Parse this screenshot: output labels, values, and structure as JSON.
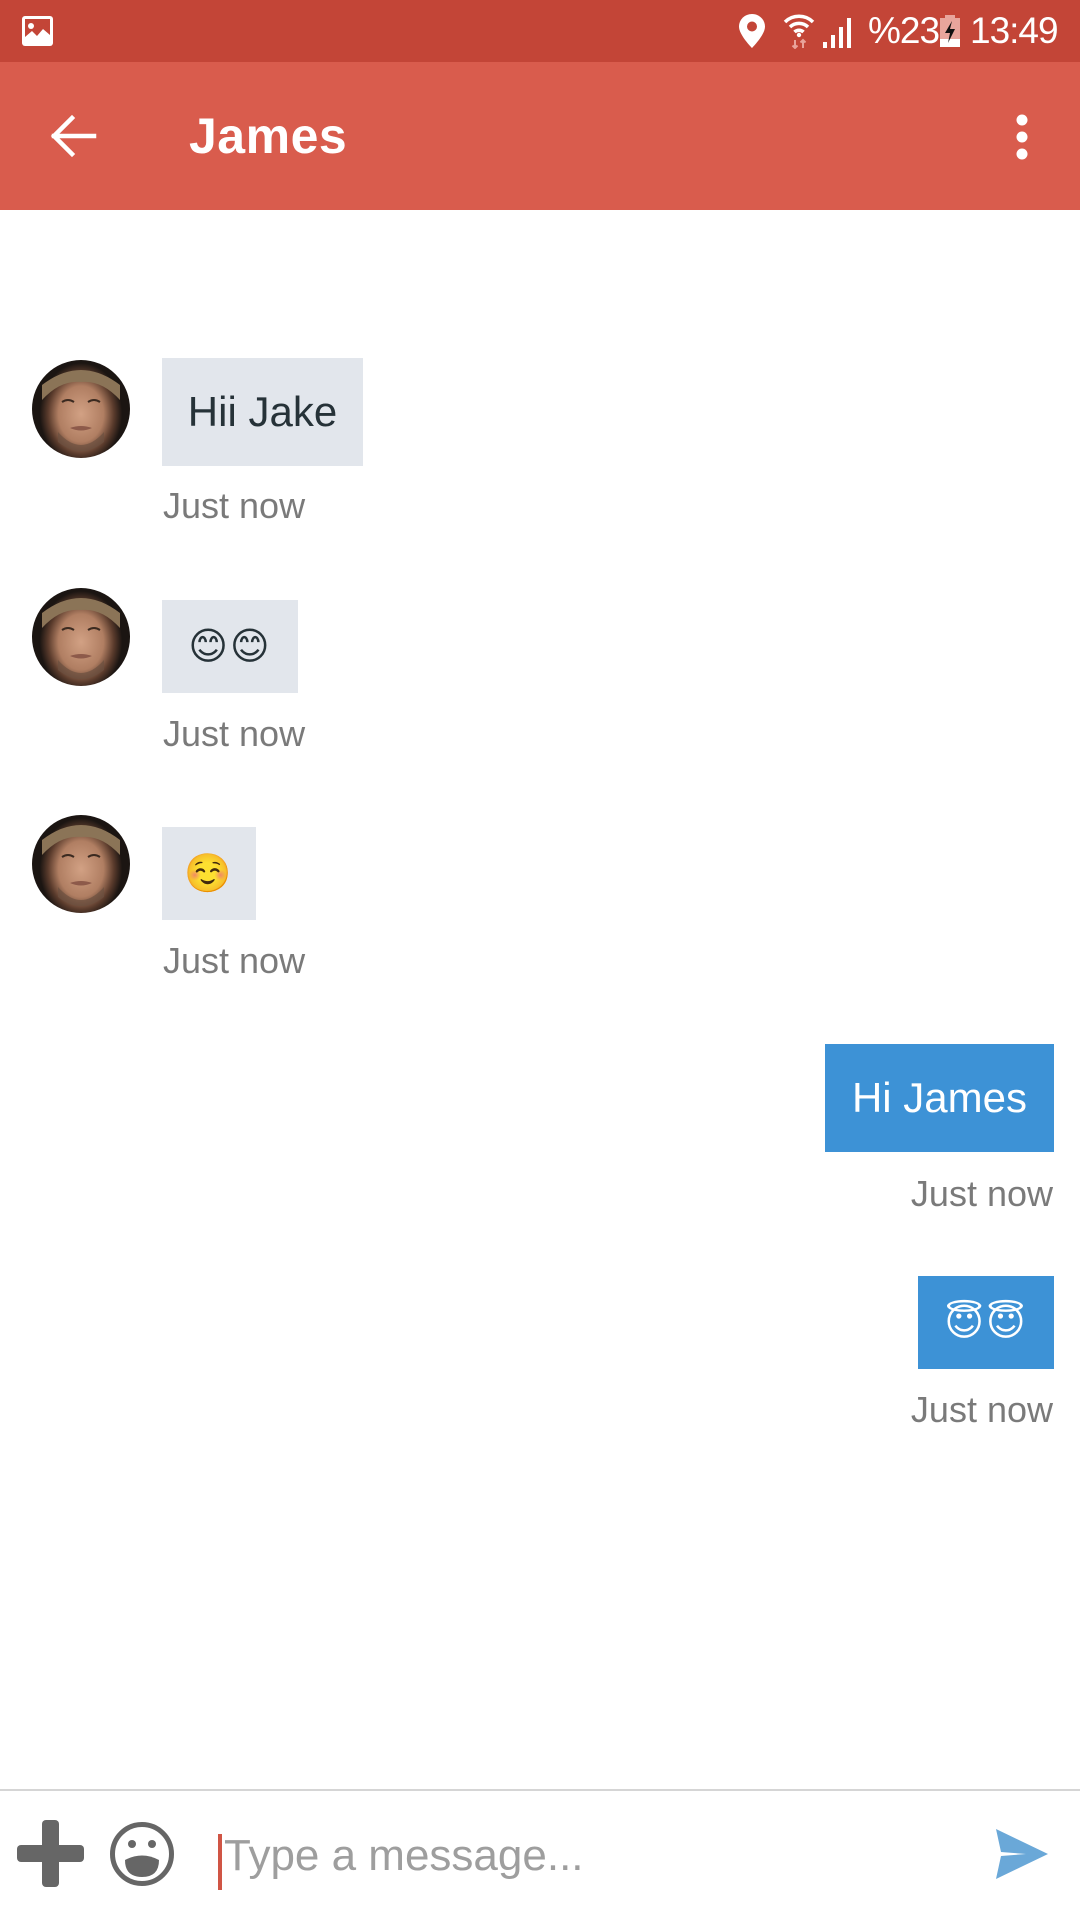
{
  "status_bar": {
    "left_icons": [
      "image-notification-icon"
    ],
    "right_icons": [
      "location-icon",
      "wifi-icon",
      "cell-signal-icon",
      "battery-charging-icon"
    ],
    "battery_text": "%23",
    "time": "13:49"
  },
  "app_bar": {
    "back_icon": "arrow-left-icon",
    "title": "James",
    "menu_icon": "more-vert-icon"
  },
  "colors": {
    "status_bar": "#c34537",
    "app_bar": "#d95c4d",
    "incoming_bubble": "#e2e6ec",
    "outgoing_bubble": "#3d92d6",
    "send_icon": "#6aa8d8",
    "timestamp": "#7a7a7a"
  },
  "messages": [
    {
      "direction": "incoming",
      "sender": "James",
      "text": "Hii Jake",
      "timestamp": "Just now",
      "type": "text"
    },
    {
      "direction": "incoming",
      "sender": "James",
      "text": "😊😊",
      "timestamp": "Just now",
      "type": "emoji"
    },
    {
      "direction": "incoming",
      "sender": "James",
      "text": "☺️",
      "timestamp": "Just now",
      "type": "emoji"
    },
    {
      "direction": "outgoing",
      "text": "Hi James",
      "timestamp": "Just now",
      "type": "text"
    },
    {
      "direction": "outgoing",
      "text": "😇😇",
      "timestamp": "Just now",
      "type": "emoji"
    }
  ],
  "composer": {
    "attach_icon": "plus-icon",
    "emoji_icon": "emoji-icon",
    "value": "",
    "placeholder": "Type a message...",
    "send_icon": "send-icon"
  }
}
